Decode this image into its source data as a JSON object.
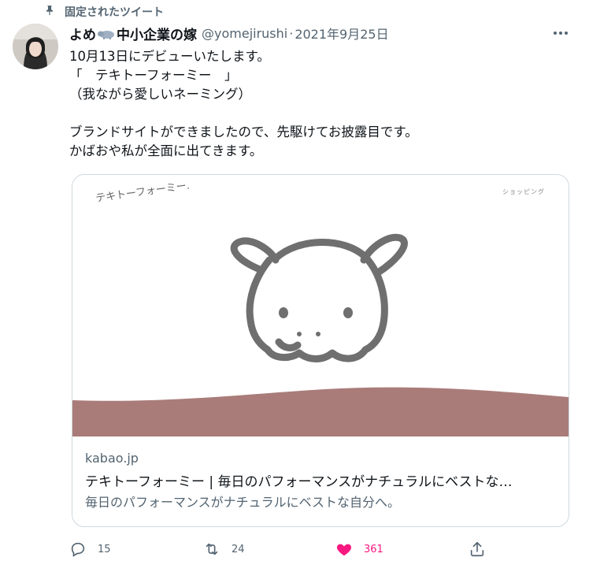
{
  "pinned": {
    "label": "固定されたツイート"
  },
  "author": {
    "name_part1": "よめ",
    "name_part2": "中小企業の嫁",
    "handle": "@yomejirushi",
    "separator": "·",
    "date": "2021年9月25日"
  },
  "tweet": {
    "text": "10月13日にデビューいたします。\n「　テキトーフォーミー　」\n（我ながら愛しいネーミング）\n\nブランドサイトができましたので、先駆けてお披露目です。\nかばおや私が全面に出てきます。"
  },
  "card": {
    "logo_text": "テキトーフォーミー.",
    "shop_label": "ショッピング",
    "domain": "kabao.jp",
    "title": "テキトーフォーミー | 毎日のパフォーマンスがナチュラルにベストな…",
    "description": "毎日のパフォーマンスがナチュラルにベストな自分へ。",
    "band_color": "#a97c7a",
    "hippo_stroke": "#6f6f6f"
  },
  "actions": {
    "reply_count": "15",
    "retweet_count": "24",
    "like_count": "361"
  },
  "colors": {
    "like": "#f91880",
    "secondary_text": "#536471",
    "border": "#cfd9de"
  }
}
